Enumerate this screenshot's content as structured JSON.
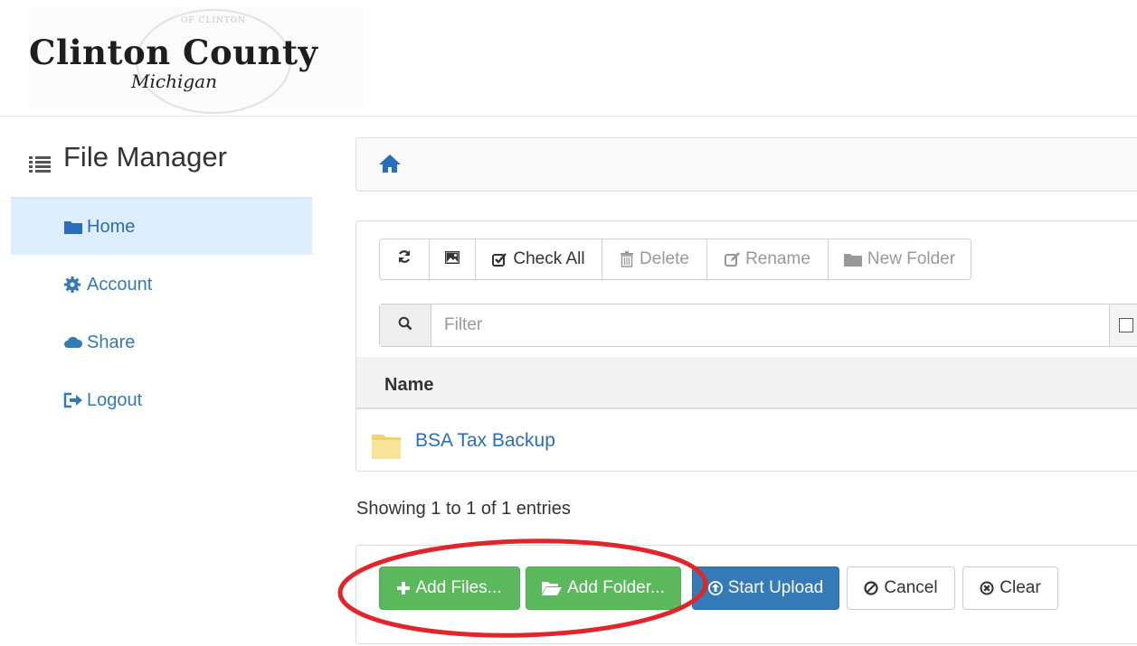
{
  "header": {
    "logo_title": "Clinton County",
    "logo_subtitle": "Michigan",
    "seal_text": "OF CLINTON"
  },
  "sidebar": {
    "title": "File Manager",
    "items": [
      {
        "label": "Home",
        "icon": "folder-icon",
        "active": true
      },
      {
        "label": "Account",
        "icon": "gear-icon",
        "active": false
      },
      {
        "label": "Share",
        "icon": "cloud-icon",
        "active": false
      },
      {
        "label": "Logout",
        "icon": "logout-icon",
        "active": false
      }
    ]
  },
  "breadcrumb": {
    "icon": "home-icon"
  },
  "toolbar": {
    "check_all": "Check All",
    "delete": "Delete",
    "rename": "Rename",
    "new_folder": "New Folder"
  },
  "filter": {
    "placeholder": "Filter"
  },
  "table": {
    "columns": [
      "Name"
    ],
    "rows": [
      {
        "name": "BSA Tax Backup",
        "type": "folder"
      }
    ]
  },
  "status": {
    "showing": "Showing 1 to 1 of 1 entries"
  },
  "upload": {
    "add_files": "Add Files...",
    "add_folder": "Add Folder...",
    "start_upload": "Start Upload",
    "cancel": "Cancel",
    "clear": "Clear"
  },
  "colors": {
    "primary": "#337ab7",
    "success": "#5cb85c",
    "annotation": "#e0262b"
  }
}
